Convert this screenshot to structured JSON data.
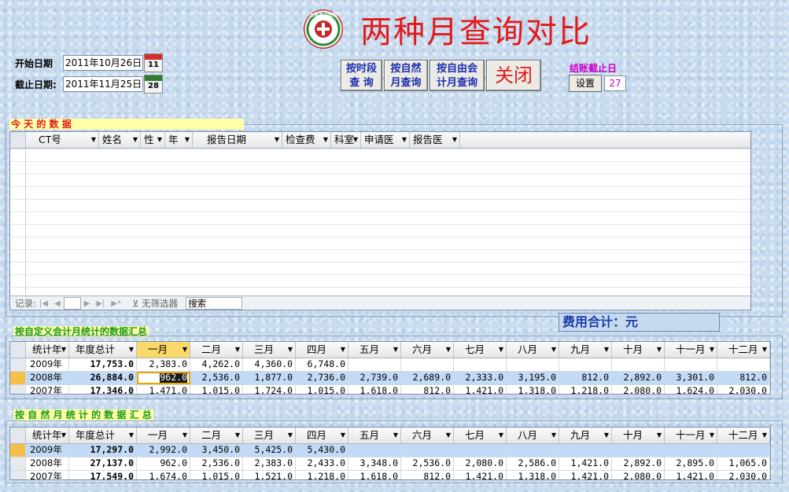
{
  "header": {
    "title": "两种月查询对比",
    "logo_text": "上海县中医院",
    "logo_icon": "hospital-cross-icon"
  },
  "dates": {
    "start_label": "开始日期",
    "start_value": "2011年10月26日",
    "start_cal": "11",
    "end_label": "截止日期:",
    "end_value": "2011年11月25日",
    "end_cal": "28"
  },
  "buttons": {
    "by_period": "按时段\n查  询",
    "by_natural": "按自然\n月查询",
    "by_custom": "按自由会\n计月查询",
    "close": "关闭"
  },
  "settlement": {
    "label": "结账截止日",
    "set_button": "设置",
    "day": "27"
  },
  "today": {
    "section_label": "今        天        的        数        据",
    "columns": [
      "CT号",
      "姓名",
      "性",
      "年",
      "报告日期",
      "检查费",
      "科室",
      "申请医",
      "报告医"
    ],
    "nav_record_label": "记录:",
    "nav_filter": "无筛选器",
    "nav_search": "搜索"
  },
  "custom": {
    "section_label": "按自定义会计月统计的数据汇总",
    "total_label": "费用合计：元",
    "columns": [
      "统计年",
      "年度总计",
      "一月",
      "二月",
      "三月",
      "四月",
      "五月",
      "六月",
      "七月",
      "八月",
      "九月",
      "十月",
      "十一月",
      "十二月"
    ],
    "rows": [
      {
        "year": "2009年",
        "total": "17,753.0",
        "m": [
          "2,383.0",
          "4,262.0",
          "4,360.0",
          "6,748.0",
          "",
          "",
          "",
          "",
          "",
          "",
          "",
          ""
        ]
      },
      {
        "year": "2008年",
        "total": "26,884.0",
        "m": [
          "962.0",
          "2,536.0",
          "1,877.0",
          "2,736.0",
          "2,739.0",
          "2,689.0",
          "2,333.0",
          "3,195.0",
          "812.0",
          "2,892.0",
          "3,301.0",
          "812.0"
        ]
      },
      {
        "year": "2007年",
        "total": "17,346.0",
        "m": [
          "1,471.0",
          "1,015.0",
          "1,724.0",
          "1,015.0",
          "1,618.0",
          "812.0",
          "1,421.0",
          "1,318.0",
          "1,218.0",
          "2,080.0",
          "1,624.0",
          "2,030.0"
        ]
      }
    ]
  },
  "natural": {
    "section_label": "按 自 然 月 统 计 的 数 据 汇 总",
    "columns": [
      "统计年",
      "年度总计",
      "一月",
      "二月",
      "三月",
      "四月",
      "五月",
      "六月",
      "七月",
      "八月",
      "九月",
      "十月",
      "十一月",
      "十二月"
    ],
    "rows": [
      {
        "year": "2009年",
        "total": "17,297.0",
        "m": [
          "2,992.0",
          "3,450.0",
          "5,425.0",
          "5,430.0",
          "",
          "",
          "",
          "",
          "",
          "",
          "",
          ""
        ]
      },
      {
        "year": "2008年",
        "total": "27,137.0",
        "m": [
          "962.0",
          "2,536.0",
          "2,383.0",
          "2,433.0",
          "3,348.0",
          "2,536.0",
          "2,080.0",
          "2,586.0",
          "1,421.0",
          "2,892.0",
          "2,895.0",
          "1,065.0"
        ]
      },
      {
        "year": "2007年",
        "total": "17,549.0",
        "m": [
          "1,674.0",
          "1,015.0",
          "1,521.0",
          "1,218.0",
          "1,618.0",
          "812.0",
          "1,421.0",
          "1,318.0",
          "1,421.0",
          "2,080.0",
          "1,421.0",
          "2,030.0"
        ]
      }
    ]
  },
  "colors": {
    "title_red": "#e21a1a",
    "button_blue": "#1a2fb0",
    "magenta": "#c800c8",
    "section_green": "#1a9a1a",
    "highlight_row": "#c2daf5"
  }
}
